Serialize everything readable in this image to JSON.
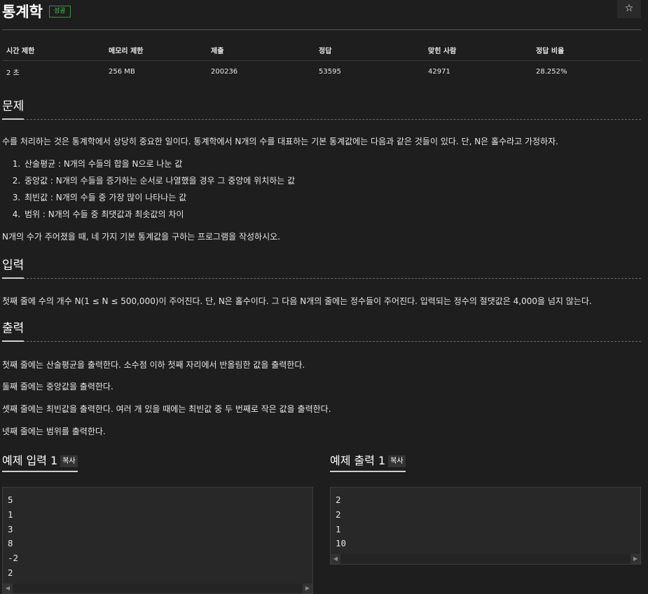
{
  "title": "통계학",
  "badge": "성공",
  "star_icon": "☆",
  "info": {
    "headers": [
      "시간 제한",
      "메모리 제한",
      "제출",
      "정답",
      "맞힌 사람",
      "정답 비율"
    ],
    "values": [
      "2 초",
      "256 MB",
      "200236",
      "53595",
      "42971",
      "28.252%"
    ]
  },
  "problem": {
    "heading": "문제",
    "intro": "수를 처리하는 것은 통계학에서 상당히 중요한 일이다. 통계학에서 N개의 수를 대표하는 기본 통계값에는 다음과 같은 것들이 있다. 단, N은 홀수라고 가정하자.",
    "items": [
      "산술평균 : N개의 수들의 합을 N으로 나눈 값",
      "중앙값 : N개의 수들을 증가하는 순서로 나열했을 경우 그 중앙에 위치하는 값",
      "최빈값 : N개의 수들 중 가장 많이 나타나는 값",
      "범위 : N개의 수들 중 최댓값과 최솟값의 차이"
    ],
    "outro": "N개의 수가 주어졌을 때, 네 가지 기본 통계값을 구하는 프로그램을 작성하시오."
  },
  "input": {
    "heading": "입력",
    "text": "첫째 줄에 수의 개수 N(1 ≤ N ≤ 500,000)이 주어진다. 단, N은 홀수이다. 그 다음 N개의 줄에는 정수들이 주어진다. 입력되는 정수의 절댓값은 4,000을 넘지 않는다."
  },
  "output": {
    "heading": "출력",
    "lines": [
      "첫째 줄에는 산술평균을 출력한다. 소수점 이하 첫째 자리에서 반올림한 값을 출력한다.",
      "둘째 줄에는 중앙값을 출력한다.",
      "셋째 줄에는 최빈값을 출력한다. 여러 개 있을 때에는 최빈값 중 두 번째로 작은 값을 출력한다.",
      "넷째 줄에는 범위를 출력한다."
    ]
  },
  "sample_input": {
    "heading": "예제 입력 1",
    "copy_label": "복사",
    "lines": [
      "5",
      "1",
      "3",
      "8",
      "-2",
      "2"
    ]
  },
  "sample_output": {
    "heading": "예제 출력 1",
    "copy_label": "복사",
    "lines": [
      "2",
      "2",
      "1",
      "10"
    ]
  }
}
